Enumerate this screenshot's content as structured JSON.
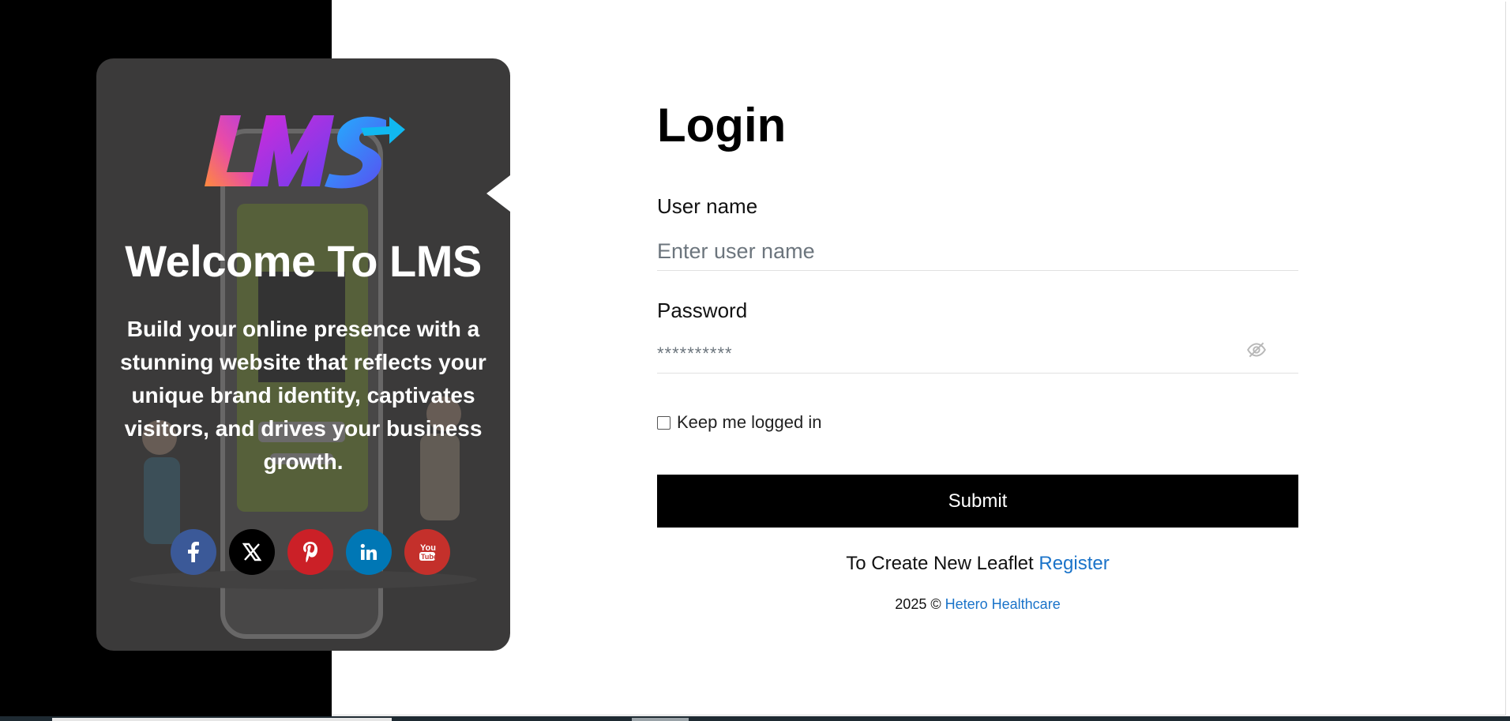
{
  "brand": {
    "logo_text": "LMS",
    "welcome": "Welcome To LMS",
    "tagline": "Build your online presence with a stunning website that reflects your unique brand identity, captivates visitors, and drives your business growth."
  },
  "socials": [
    {
      "name": "facebook-icon",
      "glyph": "f",
      "color": "#3b5998"
    },
    {
      "name": "x-icon",
      "glyph": "𝕏",
      "color": "#000000"
    },
    {
      "name": "pinterest-icon",
      "glyph": "p",
      "color": "#cb2027"
    },
    {
      "name": "linkedin-icon",
      "glyph": "in",
      "color": "#0077b5"
    },
    {
      "name": "youtube-icon",
      "glyph": "▶",
      "color": "#c4302b"
    }
  ],
  "form": {
    "title": "Login",
    "username_label": "User name",
    "username_placeholder": "Enter user name",
    "username_value": "",
    "password_label": "Password",
    "password_placeholder": "**********",
    "password_value": "",
    "remember_label": "Keep me logged in",
    "remember_checked": false,
    "submit_label": "Submit",
    "create_text": "To Create New Leaflet",
    "register_link": "Register"
  },
  "footer": {
    "year": "2025 ©",
    "company": "Hetero Healthcare"
  },
  "colors": {
    "card_bg": "#3b3a3a",
    "link": "#1a73c9",
    "submit_bg": "#000000"
  }
}
